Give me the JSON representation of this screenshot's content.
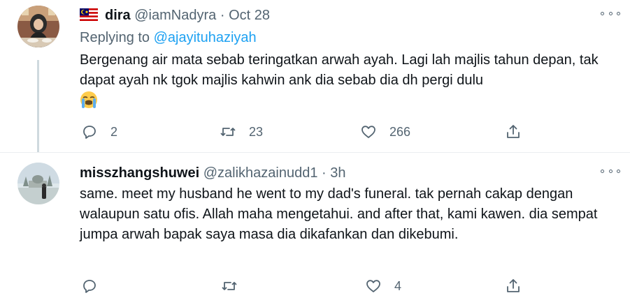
{
  "tweets": [
    {
      "display_name": "dira",
      "handle": "@iamNadyra",
      "separator": "·",
      "time": "Oct 28",
      "replying_label": "Replying to",
      "replying_to": "@ajayituhaziyah",
      "text": "Bergenang air mata sebab teringatkan arwah ayah. Lagi lah majlis tahun depan, tak dapat ayah nk tgok majlis kahwin ank dia sebab dia dh pergi dulu",
      "emoji": "loudly-crying-face",
      "reply_count": "2",
      "retweet_count": "23",
      "like_count": "266"
    },
    {
      "display_name": "misszhangshuwei",
      "handle": "@zalikhazainudd1",
      "separator": "·",
      "time": "3h",
      "text": "same. meet my husband he went to my dad's funeral. tak pernah cakap dengan walaupun satu ofis. Allah maha mengetahui. and after that, kami kawen. dia sempat jumpa arwah bapak saya masa dia dikafankan dan dikebumi.",
      "reply_count": "",
      "retweet_count": "",
      "like_count": "4"
    }
  ],
  "colors": {
    "link": "#1da1f2",
    "muted": "#536471",
    "divider": "#ebeef0"
  }
}
